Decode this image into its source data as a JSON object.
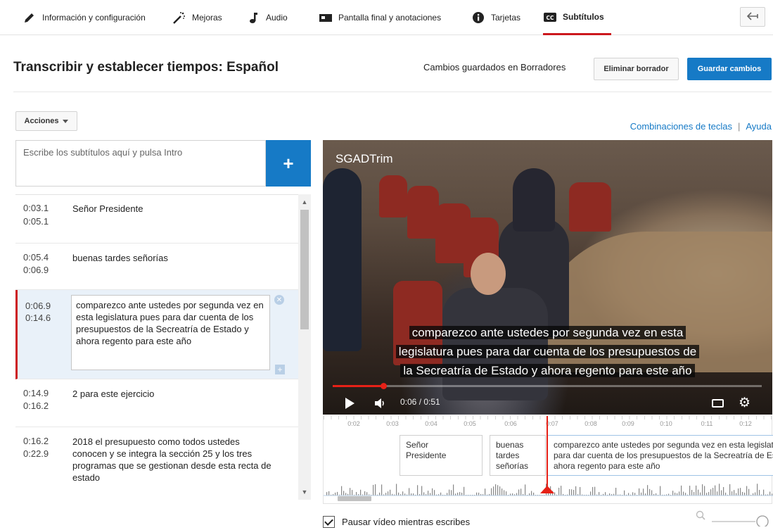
{
  "nav": {
    "tabs": [
      {
        "label": "Información y configuración",
        "icon": "pencil-icon"
      },
      {
        "label": "Mejoras",
        "icon": "magic-wand-icon"
      },
      {
        "label": "Audio",
        "icon": "music-note-icon"
      },
      {
        "label": "Pantalla final y anotaciones",
        "icon": "end-screen-icon"
      },
      {
        "label": "Tarjetas",
        "icon": "info-icon"
      },
      {
        "label": "Subtítulos",
        "icon": "cc-icon",
        "active": true
      }
    ],
    "back_icon": "back-arrow-icon"
  },
  "header": {
    "title": "Transcribir y establecer tiempos: Español",
    "status": "Cambios guardados en Borradores",
    "delete_label": "Eliminar borrador",
    "save_label": "Guardar cambios"
  },
  "toolbar": {
    "actions_label": "Acciones",
    "shortcuts_link": "Combinaciones de teclas",
    "separator": "|",
    "help_link": "Ayuda"
  },
  "editor": {
    "placeholder": "Escribe los subtítulos aquí y pulsa Intro",
    "add_label": "+"
  },
  "subtitles": [
    {
      "start": "0:03.1",
      "end": "0:05.1",
      "text": "Señor Presidente"
    },
    {
      "start": "0:05.4",
      "end": "0:06.9",
      "text": "buenas tardes señorías"
    },
    {
      "start": "0:06.9",
      "end": "0:14.6",
      "text": "comparezco ante ustedes por segunda vez en esta legislatura pues para dar cuenta de los presupuestos de la Secreatría de Estado y ahora regento para este año",
      "selected": true
    },
    {
      "start": "0:14.9",
      "end": "0:16.2",
      "text": "2 para este ejercicio"
    },
    {
      "start": "0:16.2",
      "end": "0:22.9",
      "text": "2018 el presupuesto como todos ustedes conocen y se integra la sección 25 y los tres programas que se gestionan desde esta recta de estado"
    }
  ],
  "video": {
    "channel": "SGADTrim",
    "caption_lines": [
      "comparezco ante ustedes por segunda vez en esta",
      "legislatura pues para dar cuenta de los presupuestos de",
      "la Secreatría de Estado y ahora regento para este año"
    ],
    "time": "0:06 / 0:51",
    "progress": 0.118
  },
  "timeline": {
    "ticks": [
      "0:02",
      "0:03",
      "0:04",
      "0:05",
      "0:06",
      "0:07",
      "0:08",
      "0:09",
      "0:10",
      "0:11",
      "0:12"
    ],
    "cues": [
      {
        "text": "Señor\nPresidente"
      },
      {
        "text": "buenas\ntardes\nseñorías"
      },
      {
        "text": "comparezco ante ustedes por segunda vez en esta legislatura\npara dar cuenta de los presupuestos de la Secreatría de Estado y\nahora regento para este año"
      }
    ]
  },
  "options": {
    "pause_label": "Pausar vídeo mientras escribes",
    "pause_checked": true,
    "zoom_icon": "magnifier-icon"
  },
  "colors": {
    "accent_blue": "#167ac6",
    "accent_red": "#cc181e"
  }
}
